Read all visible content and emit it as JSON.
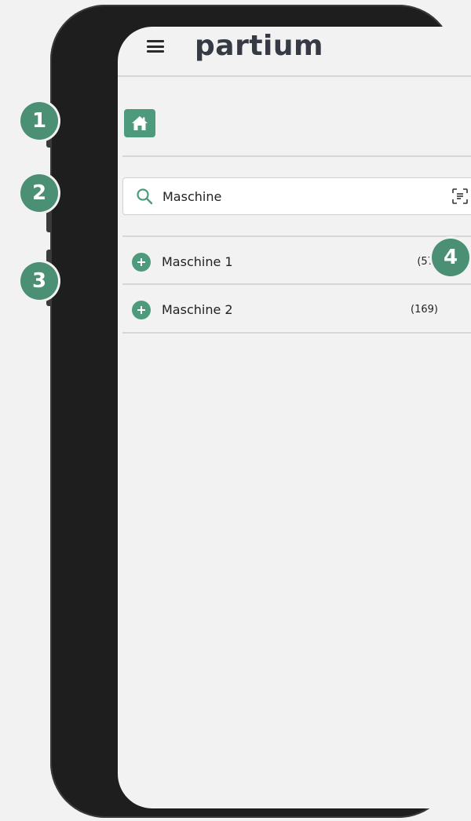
{
  "app": {
    "logo_text": "partium"
  },
  "search": {
    "value": "Maschine",
    "placeholder": ""
  },
  "results": [
    {
      "label": "Maschine 1",
      "count": "(57)"
    },
    {
      "label": "Maschine 2",
      "count": "(169)"
    }
  ],
  "callouts": [
    "1",
    "2",
    "3",
    "4"
  ],
  "icons": {
    "menu": "hamburger-icon",
    "home": "home-icon",
    "search": "search-icon",
    "scan": "scan-document-icon",
    "expand": "plus-circle-icon",
    "navigate": "arrow-right-icon"
  },
  "colors": {
    "accent": "#4e9a7c",
    "callout": "#4b8f75",
    "logo": "#363a45"
  }
}
